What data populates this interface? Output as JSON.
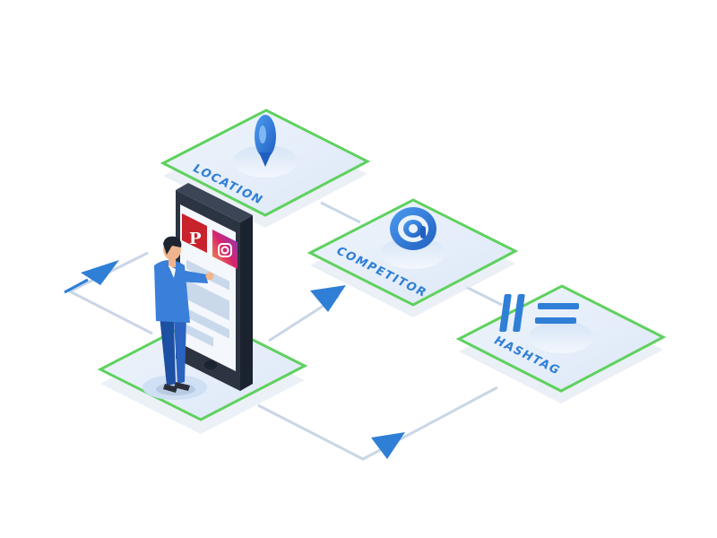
{
  "diagram": {
    "platforms": [
      {
        "id": "location",
        "label": "LOCATION",
        "icon": "location-pin-icon"
      },
      {
        "id": "competitor",
        "label": "COMPETITOR",
        "icon": "at-sign-icon"
      },
      {
        "id": "hashtag",
        "label": "HASHTAG",
        "icon": "hashtag-icon"
      }
    ],
    "phone_apps": [
      {
        "name": "pinterest",
        "icon": "pinterest-icon",
        "color": "#c8232c"
      },
      {
        "name": "instagram",
        "icon": "instagram-icon",
        "color": "#c13584"
      }
    ],
    "colors": {
      "platform_top": "#e8f0fb",
      "platform_edge": "#5fd15f",
      "label": "#2f7fd6",
      "arrow": "#2f7fd6",
      "connector": "#c9d6e6"
    }
  }
}
